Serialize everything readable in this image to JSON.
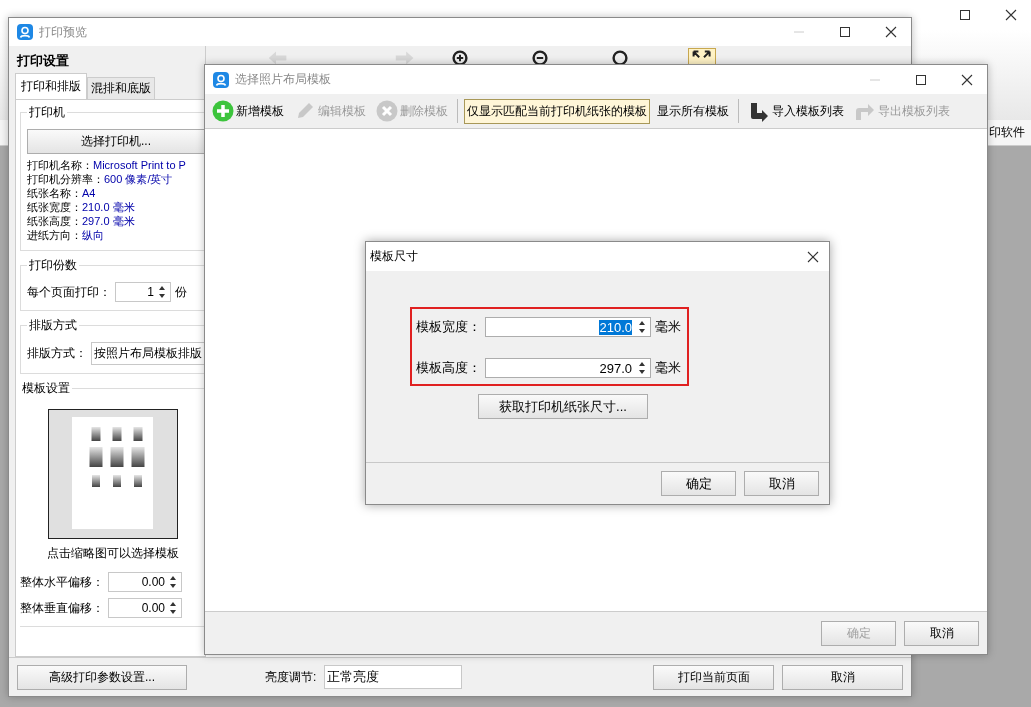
{
  "main_window": {
    "header_text": "印软件"
  },
  "preview_window": {
    "title": "打印预览",
    "panel_title": "打印设置",
    "tabs": [
      {
        "label": "打印和排版",
        "selected": true
      },
      {
        "label": "混排和底版",
        "selected": false
      }
    ],
    "printer_group": {
      "title": "打印机",
      "button": "选择打印机...",
      "info": [
        {
          "label": "打印机名称：",
          "value": "Microsoft Print to P"
        },
        {
          "label": "打印机分辨率：",
          "value": "600 像素/英寸"
        },
        {
          "label": "纸张名称：",
          "value": "A4"
        },
        {
          "label": "纸张宽度：",
          "value": "210.0 毫米"
        },
        {
          "label": "纸张高度：",
          "value": "297.0 毫米"
        },
        {
          "label": "进纸方向：",
          "value": "纵向"
        }
      ]
    },
    "copies_group": {
      "title": "打印份数",
      "label": "每个页面打印：",
      "value": "1",
      "unit": "份"
    },
    "layout_group": {
      "title": "排版方式",
      "label": "排版方式：",
      "value": "按照片布局模板排版"
    },
    "template_group": {
      "title": "模板设置",
      "caption": "点击缩略图可以选择模板",
      "offsets": [
        {
          "label": "整体水平偏移：",
          "value": "0.00"
        },
        {
          "label": "整体垂直偏移：",
          "value": "0.00"
        }
      ]
    },
    "toolbar": [
      {
        "kind": "prev",
        "selected": false
      },
      {
        "kind": "next",
        "selected": false
      },
      {
        "kind": "zoom-in",
        "selected": false
      },
      {
        "kind": "zoom-out",
        "selected": false
      },
      {
        "kind": "actual",
        "selected": false
      },
      {
        "kind": "fit",
        "selected": true
      }
    ],
    "bottom": {
      "advanced_button": "高级打印参数设置...",
      "brightness_label": "亮度调节:",
      "brightness_value": "正常亮度",
      "print_button": "打印当前页面",
      "cancel_button": "取消"
    }
  },
  "template_window": {
    "title": "选择照片布局模板",
    "toolbar": [
      {
        "kind": "add",
        "label": "新增模板",
        "disabled": false
      },
      {
        "kind": "edit",
        "label": "编辑模板",
        "disabled": true
      },
      {
        "kind": "delete",
        "label": "删除模板",
        "disabled": true
      },
      {
        "kind": "filter",
        "label": "仅显示匹配当前打印机纸张的模板",
        "selected": true
      },
      {
        "kind": "filter",
        "label": "显示所有模板",
        "selected": false
      },
      {
        "kind": "import",
        "label": "导入模板列表",
        "disabled": false
      },
      {
        "kind": "export",
        "label": "导出模板列表",
        "disabled": true
      }
    ],
    "ok_button": {
      "label": "确定",
      "disabled": true
    },
    "cancel_button": {
      "label": "取消",
      "disabled": false
    }
  },
  "size_dialog": {
    "title": "模板尺寸",
    "fields": [
      {
        "label": "模板宽度：",
        "value": "210.0",
        "selected": true,
        "unit": "毫米"
      },
      {
        "label": "模板高度：",
        "value": "297.0",
        "selected": false,
        "unit": "毫米"
      }
    ],
    "fetch_button": "获取打印机纸张尺寸...",
    "ok_button": "确定",
    "cancel_button": "取消"
  }
}
